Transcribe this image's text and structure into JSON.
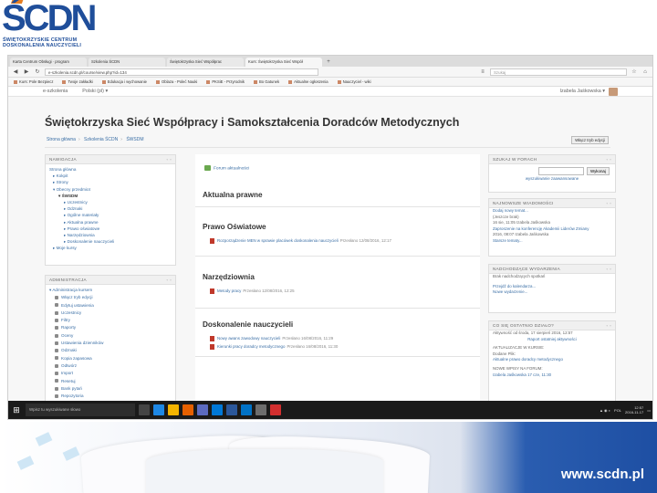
{
  "logo": {
    "big": "ŚCDN",
    "line1": "ŚWIĘTOKRZYSKIE CENTRUM",
    "line2": "DOSKONALENIA NAUCZYCIELI"
  },
  "browser": {
    "tabs": [
      {
        "label": "Karta Centrum Obsługi · program"
      },
      {
        "label": "Szkolenia ŚCDN"
      },
      {
        "label": "Świętokrzyska Sieć Współprac"
      },
      {
        "label": "Kurs: Świętokrzyska Sieć Współ"
      }
    ],
    "new_tab": "+",
    "url": "e-szkolenia.scdn.pl/course/view.php?id=134",
    "search_placeholder": "Szukaj",
    "bookmarks": [
      "Kurs: Pole Bezpiecz",
      "Twoje zakładki",
      "Edukacja i wychowanie",
      "Oblaza - Poleć Nauki",
      "PKSiE - Przyrodnik",
      "Bo Gatunek",
      "Aktualne ogłoszenia",
      "Nauczyciel - wiki"
    ]
  },
  "moodle": {
    "brand": "e-szkolenia",
    "menu": "Polski (pl) ▾",
    "user": "Izabela Jaśkowska ▾"
  },
  "page": {
    "title": "Świętokrzyska Sieć Współpracy i Samokształcenia Doradców Metodycznych",
    "breadcrumb": [
      "Strona główna",
      "Szkolenia ŚCDN",
      "ŚWSDM"
    ],
    "block_button": "Włącz tryb edycji"
  },
  "nav_block": {
    "title": "NAWIGACJA",
    "items": [
      {
        "label": "Strona główna",
        "level": 0
      },
      {
        "label": "▸ Kokpit",
        "level": 1
      },
      {
        "label": "▸ Strony",
        "level": 1
      },
      {
        "label": "▾ Obecny przedmiot",
        "level": 1
      },
      {
        "label": "▾ ŚWSDM",
        "level": 2,
        "bold": true
      },
      {
        "label": "▸ Uczestnicy",
        "level": 3
      },
      {
        "label": "▸ Odznaki",
        "level": 3
      },
      {
        "label": "▸ Ogólne materiały",
        "level": 3
      },
      {
        "label": "▸ Aktualna prawne",
        "level": 3
      },
      {
        "label": "▸ Prawo oświatowe",
        "level": 3
      },
      {
        "label": "▸ Narzędziownia",
        "level": 3
      },
      {
        "label": "▸ Doskonalenie nauczycieli",
        "level": 3
      },
      {
        "label": "▸ Moje kursy",
        "level": 1
      }
    ]
  },
  "admin_block": {
    "title": "ADMINISTRACJA",
    "items": [
      "▾ Administracja kursem",
      "Włącz tryb edycji",
      "Edytuj ustawienia",
      "Uczestnicy",
      "Filtry",
      "Raporty",
      "Oceny",
      "Ustawienia dzienników",
      "Odznaki",
      "Kopia zapasowa",
      "Odtwórz",
      "Import",
      "Resetuj",
      "Bank pytań",
      "Repozytoria"
    ]
  },
  "main": {
    "forum_link": "Forum aktualności",
    "sections": [
      {
        "title": "Aktualna prawne",
        "resources": []
      },
      {
        "title": "Prawo Oświatowe",
        "resources": [
          {
            "label": "Rozporządzenie MEN w sprawie placówek doskonalenia nauczycieli",
            "meta": "Przesłano 12/08/2016, 12:17"
          }
        ]
      },
      {
        "title": "Narzędziownia",
        "resources": [
          {
            "label": "Metody pracy",
            "meta": "Przesłano 12/08/2016, 12:25"
          }
        ]
      },
      {
        "title": "Doskonalenie nauczycieli",
        "resources": [
          {
            "label": "Nowy awans zawodowy nauczycieli",
            "meta": "Przesłano 16/08/2016, 11:29"
          },
          {
            "label": "Kierunki pracy doradcy metodycznego",
            "meta": "Przesłano 16/08/2016, 11:30"
          }
        ]
      }
    ]
  },
  "right_blocks": {
    "search": {
      "title": "SZUKAJ W FORACH",
      "button": "Wykonaj",
      "advanced": "wyszukiwanie zaawansowane"
    },
    "news": {
      "title": "NAJNOWSZE WIADOMOŚCI",
      "lines": [
        "Dodaj nowy temat...",
        "(Jeszcze brak)",
        "16 sie, 11:05 Izabela Jaśkowska",
        "Zaproszenie na konferencję Akademii Liderów Zmiany",
        "2016, 08:07 Izabela Jaśkowska"
      ],
      "more": "Starsze tematy..."
    },
    "events": {
      "title": "NADCHODZĄCE WYDARZENIA",
      "lines": [
        "Brak nadchodzących spotkań"
      ],
      "links": [
        "Przejdź do kalendarza...",
        "Nowe wydarzenie..."
      ]
    },
    "recent": {
      "title": "CO SIĘ OSTATNIO DZIAŁO?",
      "lines": [
        "Aktywność od środa, 17 sierpień 2016, 12:57",
        "Raport ostatniej aktywności",
        "AKTUALIZACJE W KURSIE:",
        "Dodane Plik:",
        "Aktualne prawo doradcy metodycznego",
        "NOWE WPISY NA FORUM:",
        "Izabela Jaśkowska 17 cze, 11:30"
      ]
    }
  },
  "taskbar": {
    "start": "⊞",
    "search_placeholder": "Wpisz tu wyszukiwane słowo",
    "clock_time": "12:57",
    "clock_date": "2016-11-17",
    "lang": "POL"
  },
  "banner": {
    "url": "www.scdn.pl"
  },
  "colors": {
    "brand_blue": "#1f4e9a",
    "brand_orange": "#e67e22",
    "link": "#3a6ea5",
    "banner_blue": "#1e4fa3"
  }
}
